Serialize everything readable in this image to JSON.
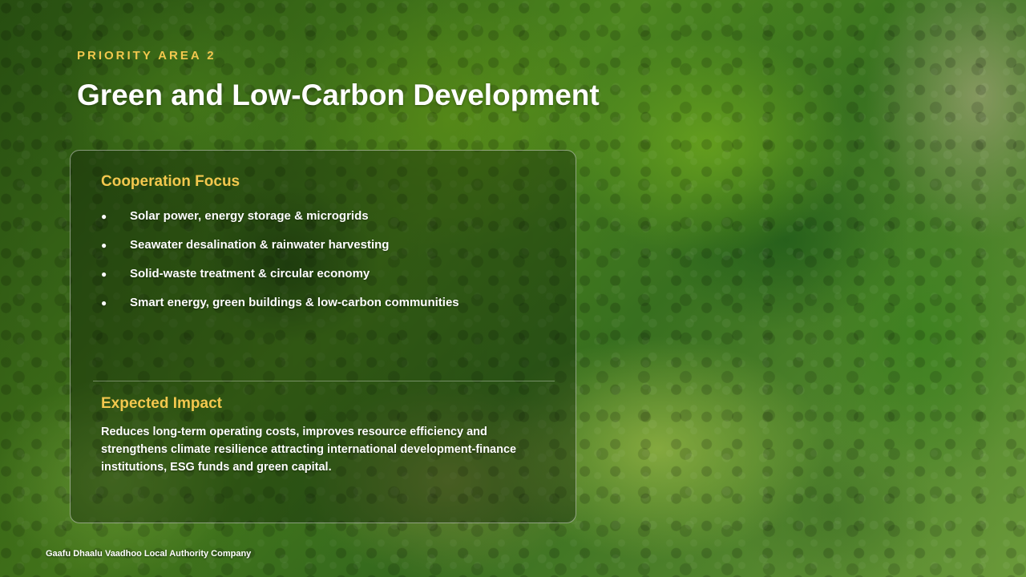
{
  "slide": {
    "eyebrow": "PRIORITY AREA 2",
    "title": "Green and Low-Carbon Development",
    "footer": "Gaafu Dhaalu Vaadhoo Local Authority Company"
  },
  "focus": {
    "heading": "Cooperation Focus",
    "bullet": "●",
    "items": [
      "Solar power, energy storage & microgrids",
      "Seawater desalination & rainwater harvesting",
      "Solid-waste treatment & circular economy",
      "Smart energy, green buildings & low-carbon communities"
    ]
  },
  "impact": {
    "heading": "Expected Impact",
    "text": "Reduces long-term operating costs, improves resource efficiency and strengthens climate resilience attracting international development-finance institutions, ESG funds and green capital."
  },
  "colors": {
    "accent": "#f3c84e",
    "text": "#ffffff"
  }
}
